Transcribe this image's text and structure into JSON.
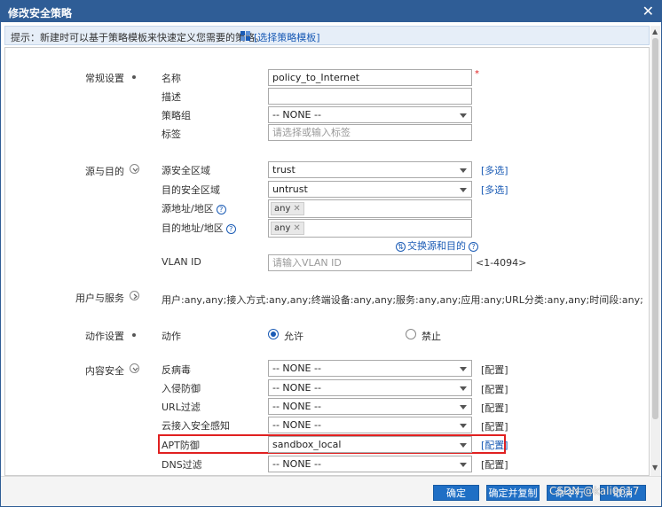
{
  "dialog": {
    "title": "修改安全策略",
    "close": "✕"
  },
  "hint": {
    "text": "提示：新建时可以基于策略模板来快速定义您需要的策略。",
    "template_link": "[选择策略模板]"
  },
  "sections": {
    "general": "常规设置",
    "source_dest": "源与目的",
    "user_service": "用户与服务",
    "action": "动作设置",
    "content_security": "内容安全"
  },
  "general": {
    "name_label": "名称",
    "name_value": "policy_to_Internet",
    "required_mark": "*",
    "desc_label": "描述",
    "desc_value": "",
    "group_label": "策略组",
    "group_value": "-- NONE --",
    "tag_label": "标签",
    "tag_placeholder": "请选择或输入标签"
  },
  "source_dest": {
    "src_zone_label": "源安全区域",
    "src_zone_value": "trust",
    "dst_zone_label": "目的安全区域",
    "dst_zone_value": "untrust",
    "multi_select": "[多选]",
    "src_addr_label": "源地址/地区",
    "dst_addr_label": "目的地址/地区",
    "any_tag": "any",
    "tag_remove": "✕",
    "swap_link": "交换源和目的",
    "vlan_label": "VLAN ID",
    "vlan_placeholder": "请输入VLAN ID",
    "vlan_range": "<1-4094>"
  },
  "user_service": {
    "summary": "用户:any,any;接入方式:any,any;终端设备:any,any;服务:any,any;应用:any;URL分类:any,any;时间段:any;"
  },
  "action": {
    "label": "动作",
    "permit": "允许",
    "deny": "禁止",
    "selected": "permit"
  },
  "content_security": {
    "configure": "[配置]",
    "items": [
      {
        "label": "反病毒",
        "value": "-- NONE --"
      },
      {
        "label": "入侵防御",
        "value": "-- NONE --"
      },
      {
        "label": "URL过滤",
        "value": "-- NONE --"
      },
      {
        "label": "云接入安全感知",
        "value": "-- NONE --"
      },
      {
        "label": "APT防御",
        "value": "sandbox_local"
      },
      {
        "label": "DNS过滤",
        "value": "-- NONE --"
      }
    ]
  },
  "footer": {
    "ok": "确定",
    "ok_copy": "确定并复制",
    "hit_analysis": "命令行",
    "cancel": "取消",
    "watermark": "CSDN @kali0617"
  },
  "colors": {
    "titlebar": "#2f5d96",
    "accent": "#1f6fc5",
    "link": "#1a5bb5",
    "highlight": "#e02020"
  }
}
